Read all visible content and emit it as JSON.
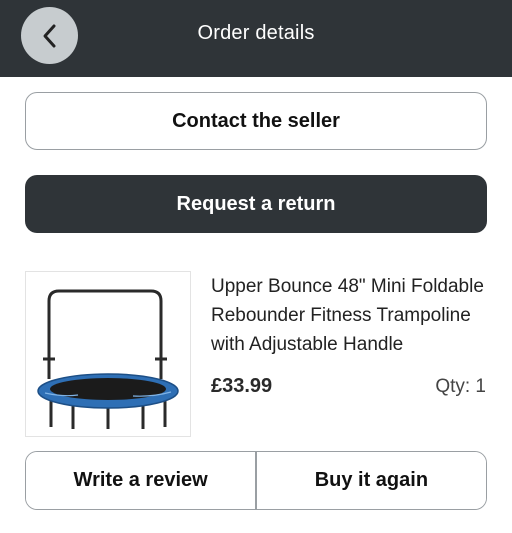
{
  "header": {
    "title": "Order details",
    "back_icon": "chevron-left-icon"
  },
  "actions": {
    "contact_label": "Contact the seller",
    "return_label": "Request a return"
  },
  "product": {
    "title": "Upper Bounce 48\" Mini Foldable Rebounder Fitness Trampoline with Adjustable Handle",
    "price": "£33.99",
    "qty": "Qty: 1",
    "image_icon": "trampoline-image"
  },
  "footer_actions": {
    "review_label": "Write a review",
    "buy_again_label": "Buy it again"
  },
  "colors": {
    "header_bg": "#2f3438",
    "back_button_bg": "#c7cccf",
    "primary_button_bg": "#2f3438",
    "outline_border": "#9a9fa3",
    "trampoline_mat": "#2e6fb5"
  }
}
